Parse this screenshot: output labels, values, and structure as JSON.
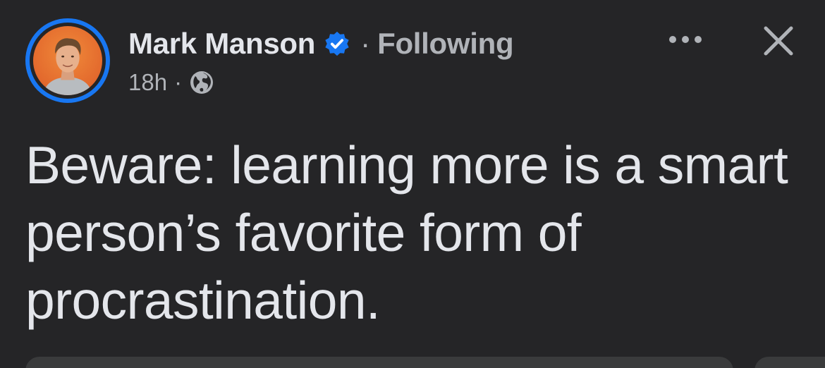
{
  "post": {
    "author": {
      "name": "Mark Manson",
      "verified_icon": "verified-badge-icon",
      "separator": "·",
      "follow_status": "Following"
    },
    "meta": {
      "timestamp": "18h",
      "separator": "·",
      "audience_icon": "globe-icon"
    },
    "actions": {
      "more_icon": "more-options-icon",
      "close_icon": "close-icon"
    },
    "text": "Beware: learning more is a smart person’s favorite form of procrastination."
  },
  "colors": {
    "background": "#252527",
    "primary_text": "#e4e6eb",
    "secondary_text": "#b0b3b8",
    "accent_blue": "#1877f2"
  }
}
